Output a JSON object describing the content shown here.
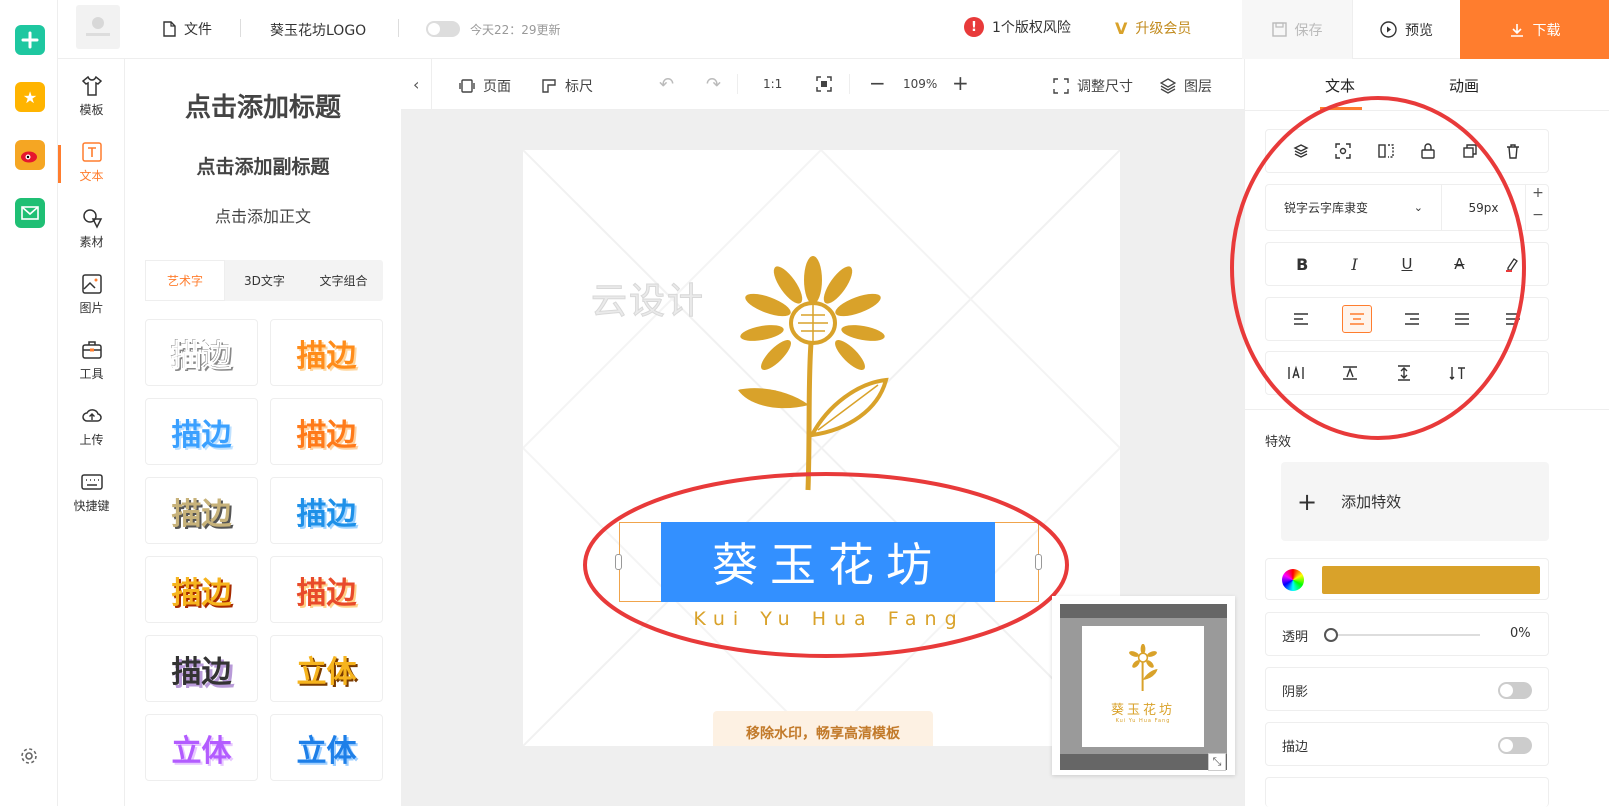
{
  "topbar": {
    "file_label": "文件",
    "doc_title": "葵玉花坊LOGO",
    "autosave_text": "今天22：29更新",
    "copyright_warning": "1个版权风险",
    "upgrade_label": "升级会员",
    "save_label": "保存",
    "preview_label": "预览",
    "download_label": "下载"
  },
  "nav": {
    "items": [
      {
        "label": "模板",
        "icon": "shirt-icon"
      },
      {
        "label": "文本",
        "icon": "text-icon"
      },
      {
        "label": "素材",
        "icon": "shapes-icon"
      },
      {
        "label": "图片",
        "icon": "image-icon"
      },
      {
        "label": "工具",
        "icon": "toolbox-icon"
      },
      {
        "label": "上传",
        "icon": "cloud-upload-icon"
      },
      {
        "label": "快捷键",
        "icon": "keyboard-icon"
      }
    ]
  },
  "textpanel": {
    "add_title": "点击添加标题",
    "add_subtitle": "点击添加副标题",
    "add_body": "点击添加正文",
    "tabs": [
      "艺术字",
      "3D文字",
      "文字组合"
    ],
    "tiles": [
      "描边",
      "描边",
      "描边",
      "描边",
      "描边",
      "描边",
      "描边",
      "描边",
      "描边",
      "立体",
      "立体",
      "立体"
    ]
  },
  "canvas_toolbar": {
    "page_label": "页面",
    "ruler_label": "标尺",
    "ratio_label": "1:1",
    "zoom_level": "109%",
    "resize_label": "调整尺寸",
    "layers_label": "图层"
  },
  "canvas": {
    "watermark_text": "云设计",
    "logo_title": "葵玉花坊",
    "logo_subtitle": "Kui Yu Hua Fang",
    "remove_watermark": "移除水印，畅享高清模板",
    "minimap_title": "葵玉花坊",
    "minimap_subtitle": "Kui Yu Hua Fang"
  },
  "rpanel": {
    "tabs": [
      "文本",
      "动画"
    ],
    "font_name": "锐字云字库隶变",
    "font_size": "59px",
    "effects_label": "特效",
    "add_effect": "添加特效",
    "text_color": "#d9a22a",
    "opacity_label": "透明",
    "opacity_value": "0%",
    "shadow_label": "阴影",
    "stroke_label": "描边"
  },
  "colors": {
    "accent": "#ff7d2e",
    "gold": "#d9a22a",
    "selection": "#3390ff",
    "annotation": "#e83a3a"
  }
}
